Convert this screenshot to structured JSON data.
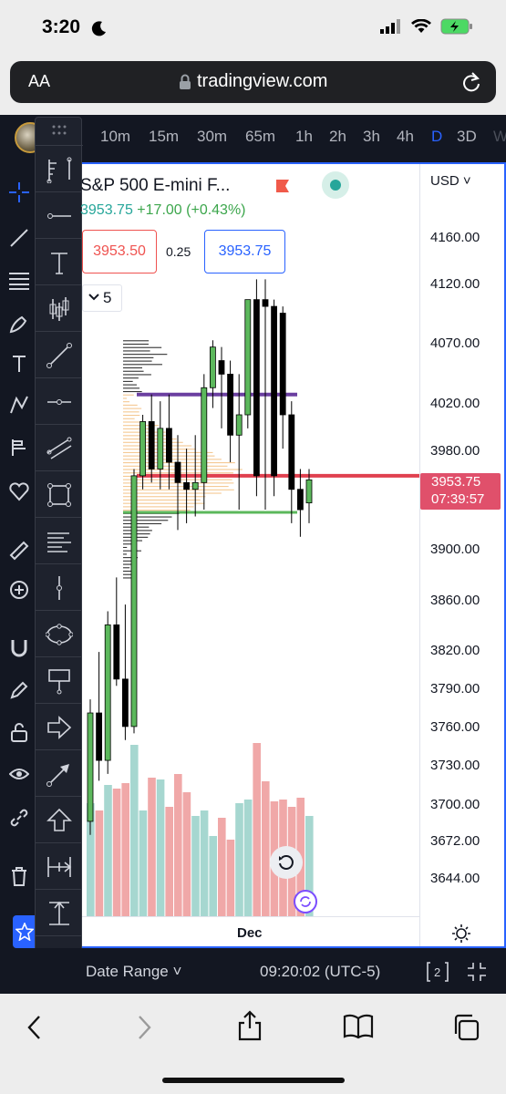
{
  "status_bar": {
    "time": "3:20"
  },
  "browser": {
    "text_size_label": "AA",
    "url": "tradingview.com"
  },
  "timeframes": [
    "10m",
    "15m",
    "30m",
    "65m",
    "1h",
    "2h",
    "3h",
    "4h",
    "D",
    "3D",
    "W"
  ],
  "active_timeframe": "D",
  "symbol": {
    "name": "S&P 500 E-mini F...",
    "last": "3953.75",
    "change": "+17.00",
    "change_pct": "(+0.43%)"
  },
  "order_panel": {
    "sell_price": "3953.50",
    "spread": "0.25",
    "buy_price": "3953.75"
  },
  "volume_profile_toggle": "5",
  "price_axis": {
    "currency": "USD",
    "labels": [
      "4160.00",
      "4120.00",
      "4070.00",
      "4020.00",
      "3980.00",
      "3900.00",
      "3860.00",
      "3820.00",
      "3790.00",
      "3760.00",
      "3730.00",
      "3700.00",
      "3672.00",
      "3644.00"
    ],
    "last_price": "3953.75",
    "countdown": "07:39:57"
  },
  "time_axis": {
    "label": "Dec"
  },
  "bottom_bar": {
    "date_range_label": "Date Range",
    "clock": "09:20:02 (UTC-5)"
  },
  "colors": {
    "up_candle": "#5cb85c",
    "down_candle": "#000000",
    "volume_up": "#a6d7d0",
    "volume_down": "#f0a8a8",
    "poc_line": "#e0404f",
    "value_area_high_line": "#6b3fa0",
    "value_area_low_line": "#5cb85c",
    "last_price_tag": "#e0506b",
    "accent": "#2962ff"
  },
  "chart_data": {
    "type": "candlestick",
    "y_range": [
      3630,
      4185
    ],
    "horizontal_levels": {
      "poc": 3955,
      "value_area_high": 4015,
      "value_area_low": 3928
    },
    "candles": [
      {
        "o": 3700,
        "h": 3790,
        "l": 3690,
        "c": 3780
      },
      {
        "o": 3780,
        "h": 3825,
        "l": 3730,
        "c": 3745
      },
      {
        "o": 3745,
        "h": 3855,
        "l": 3735,
        "c": 3845
      },
      {
        "o": 3845,
        "h": 3880,
        "l": 3800,
        "c": 3805
      },
      {
        "o": 3805,
        "h": 3860,
        "l": 3760,
        "c": 3770
      },
      {
        "o": 3770,
        "h": 3960,
        "l": 3765,
        "c": 3955
      },
      {
        "o": 3955,
        "h": 4000,
        "l": 3945,
        "c": 3995
      },
      {
        "o": 3995,
        "h": 4015,
        "l": 3950,
        "c": 3960
      },
      {
        "o": 3960,
        "h": 4010,
        "l": 3945,
        "c": 3990
      },
      {
        "o": 3990,
        "h": 4015,
        "l": 3945,
        "c": 3965
      },
      {
        "o": 3965,
        "h": 3985,
        "l": 3915,
        "c": 3950
      },
      {
        "o": 3950,
        "h": 3975,
        "l": 3920,
        "c": 3945
      },
      {
        "o": 3945,
        "h": 3985,
        "l": 3925,
        "c": 3950
      },
      {
        "o": 3950,
        "h": 4030,
        "l": 3930,
        "c": 4020
      },
      {
        "o": 4020,
        "h": 4055,
        "l": 4005,
        "c": 4050
      },
      {
        "o": 4040,
        "h": 4050,
        "l": 3990,
        "c": 4030
      },
      {
        "o": 4030,
        "h": 4040,
        "l": 3965,
        "c": 3985
      },
      {
        "o": 3985,
        "h": 4030,
        "l": 3930,
        "c": 4000
      },
      {
        "o": 4000,
        "h": 4085,
        "l": 3990,
        "c": 4085
      },
      {
        "o": 4085,
        "h": 4100,
        "l": 3940,
        "c": 3955
      },
      {
        "o": 4085,
        "h": 4100,
        "l": 3930,
        "c": 4080
      },
      {
        "o": 4080,
        "h": 4085,
        "l": 3940,
        "c": 3955
      },
      {
        "o": 4075,
        "h": 4080,
        "l": 3975,
        "c": 4000
      },
      {
        "o": 4000,
        "h": 4010,
        "l": 3920,
        "c": 3945
      },
      {
        "o": 3945,
        "h": 3960,
        "l": 3910,
        "c": 3930
      },
      {
        "o": 3935,
        "h": 3960,
        "l": 3920,
        "c": 3952
      }
    ],
    "volume": [
      0.62,
      0.58,
      0.72,
      0.7,
      0.73,
      0.94,
      0.58,
      0.76,
      0.75,
      0.6,
      0.78,
      0.68,
      0.55,
      0.58,
      0.44,
      0.54,
      0.42,
      0.62,
      0.64,
      0.95,
      0.74,
      0.63,
      0.64,
      0.6,
      0.65,
      0.55
    ]
  }
}
